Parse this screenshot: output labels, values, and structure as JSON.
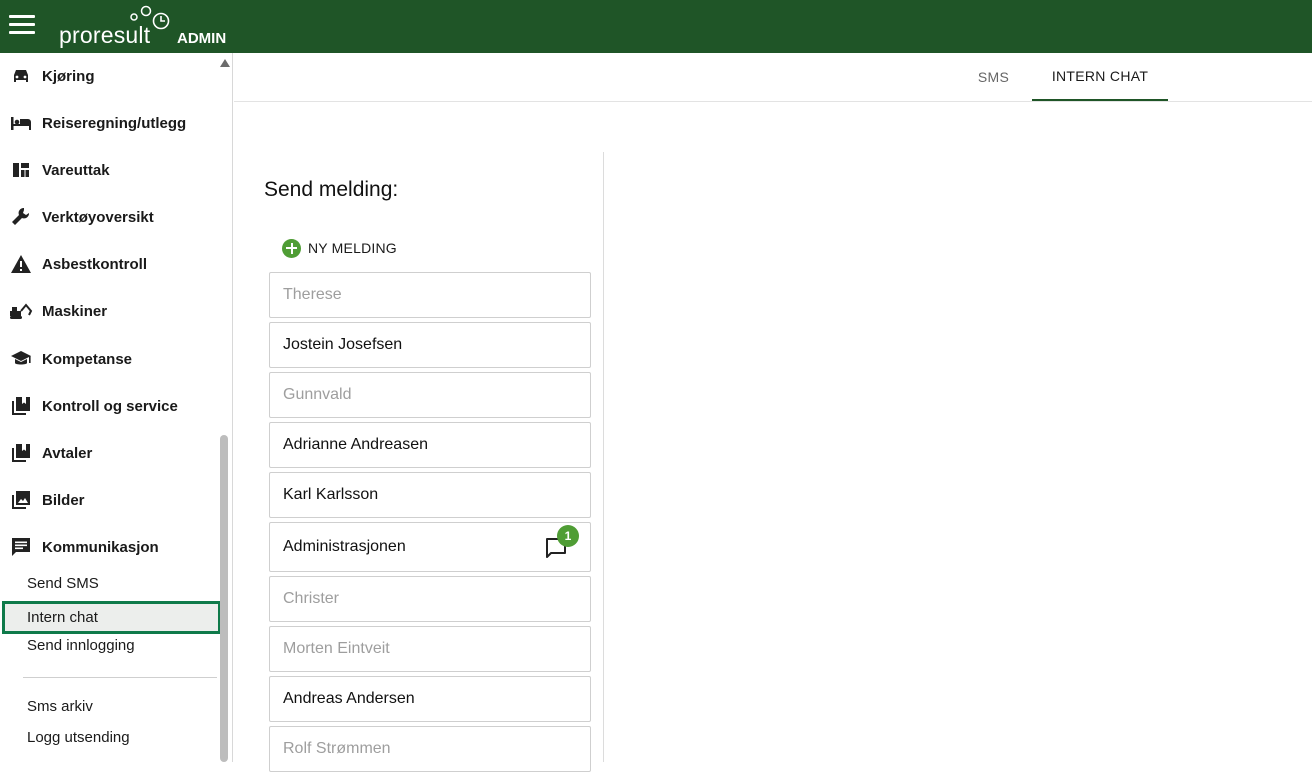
{
  "header": {
    "logo_word": "proresult",
    "logo_suffix": "ADMIN",
    "brand_color": "#1f5527"
  },
  "sidebar": {
    "items": [
      {
        "label": "Kjøring",
        "icon": "car-icon"
      },
      {
        "label": "Reiseregning/utlegg",
        "icon": "bed-icon"
      },
      {
        "label": "Vareuttak",
        "icon": "dashboard-icon"
      },
      {
        "label": "Verktøyoversikt",
        "icon": "wrench-icon"
      },
      {
        "label": "Asbestkontroll",
        "icon": "warning-icon"
      },
      {
        "label": "Maskiner",
        "icon": "excavator-icon"
      },
      {
        "label": "Kompetanse",
        "icon": "school-icon"
      },
      {
        "label": "Kontroll og service",
        "icon": "library-icon"
      },
      {
        "label": "Avtaler",
        "icon": "library-icon"
      },
      {
        "label": "Bilder",
        "icon": "image-icon"
      },
      {
        "label": "Kommunikasjon",
        "icon": "message-icon"
      }
    ],
    "sub_items": [
      {
        "label": "Send SMS"
      },
      {
        "label": "Intern chat",
        "active": true
      },
      {
        "label": "Send innlogging"
      }
    ],
    "extra_items": [
      {
        "label": "Sms arkiv"
      },
      {
        "label": "Logg utsending"
      }
    ]
  },
  "tabs": [
    {
      "label": "SMS",
      "active": false
    },
    {
      "label": "INTERN CHAT",
      "active": true
    }
  ],
  "panel": {
    "title": "Send melding:",
    "new_message_label": "NY MELDING",
    "contacts": [
      {
        "name": "Therese",
        "active": false
      },
      {
        "name": "Jostein Josefsen",
        "active": true
      },
      {
        "name": "Gunnvald",
        "active": false
      },
      {
        "name": "Adrianne Andreasen",
        "active": true
      },
      {
        "name": "Karl Karlsson",
        "active": true
      },
      {
        "name": "Administrasjonen",
        "active": true,
        "unread": "1"
      },
      {
        "name": "Christer",
        "active": false
      },
      {
        "name": "Morten Eintveit",
        "active": false
      },
      {
        "name": "Andreas Andersen",
        "active": true
      },
      {
        "name": "Rolf Strømmen",
        "active": false
      }
    ]
  },
  "colors": {
    "accent_green": "#4f9d35",
    "active_outline": "#0f7a4a"
  }
}
